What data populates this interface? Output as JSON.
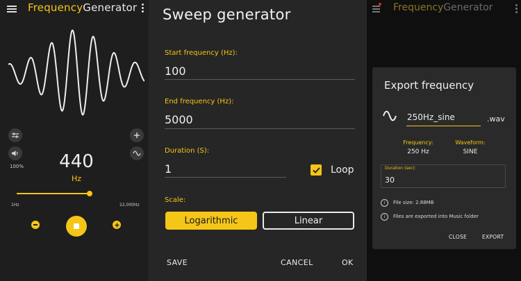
{
  "left": {
    "title_part1": "Frequency",
    "title_part2": "Generator",
    "volume_percent": "100%",
    "frequency_value": "440",
    "frequency_unit": "Hz",
    "slider_min_label": "1Hz",
    "slider_max_label": "22,000Hz",
    "accent_color": "#f5c518"
  },
  "sweep": {
    "title": "Sweep generator",
    "start_label": "Start frequency (Hz):",
    "start_value": "100",
    "end_label": "End frequency (Hz):",
    "end_value": "5000",
    "duration_label": "Duration (S):",
    "duration_value": "1",
    "loop_label": "Loop",
    "loop_checked": true,
    "scale_label": "Scale:",
    "scale_options": [
      "Logarithmic",
      "Linear"
    ],
    "scale_selected": "Logarithmic",
    "save_label": "SAVE",
    "cancel_label": "CANCEL",
    "ok_label": "OK"
  },
  "export": {
    "app_title_part1": "Frequency",
    "app_title_part2": "Generator",
    "title": "Export frequency",
    "filename": "250Hz_sine",
    "extension": ".wav",
    "frequency_label": "Frequency:",
    "frequency_value": "250 Hz",
    "waveform_label": "Waveform:",
    "waveform_value": "SINE",
    "duration_label": "Duration (sec):",
    "duration_value": "30",
    "file_size_text": "File size: 2.88MB",
    "location_text": "Files are exported into Music folder",
    "close_label": "CLOSE",
    "export_label": "EXPORT"
  }
}
